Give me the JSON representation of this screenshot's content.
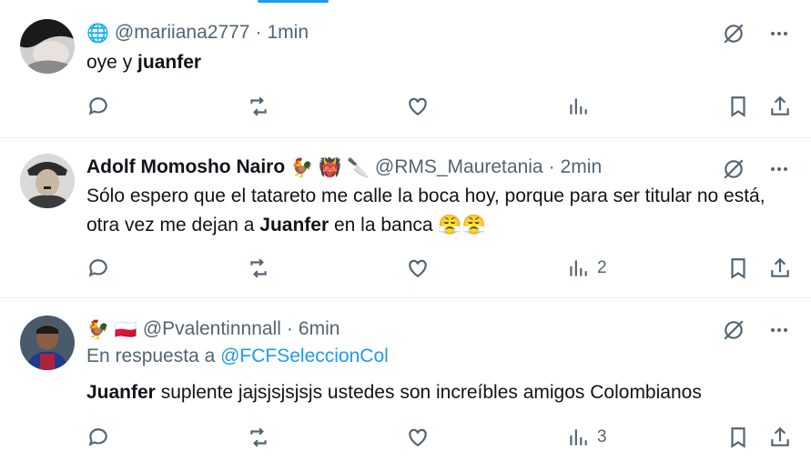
{
  "tweets": [
    {
      "avatar_icon": "avatar-photo",
      "name": "",
      "name_emojis": [],
      "handle_prefix_emojis": [
        "🌐"
      ],
      "handle": "@mariiana2777",
      "separator": "·",
      "time": "1min",
      "reply_prefix": "",
      "reply_mention": "",
      "text_before": "oye y ",
      "text_bold": "juanfer",
      "text_after": "",
      "views": ""
    },
    {
      "avatar_icon": "avatar-photo",
      "name": "Adolf Momosho Nairo",
      "name_emojis": [
        "🐓",
        "👹",
        "🔪"
      ],
      "handle_prefix_emojis": [],
      "handle": "@RMS_Mauretania",
      "separator": "·",
      "time": "2min",
      "reply_prefix": "",
      "reply_mention": "",
      "text_before": "Sólo espero que el tatareto me calle la boca hoy, porque para ser titular no está, otra vez me dejan a ",
      "text_bold": "Juanfer",
      "text_after": " en la banca 😤😤",
      "views": "2"
    },
    {
      "avatar_icon": "avatar-photo",
      "name": "",
      "name_emojis": [],
      "handle_prefix_emojis": [
        "🐓",
        "🇵🇱"
      ],
      "handle": "@Pvalentinnnall",
      "separator": "·",
      "time": "6min",
      "reply_prefix": "En respuesta a ",
      "reply_mention": "@FCFSeleccionCol",
      "text_before": "",
      "text_bold": "Juanfer",
      "text_after": " suplente jajsjsjsjsjs ustedes son increíbles amigos Colombianos",
      "views": "3"
    }
  ],
  "colors": {
    "accent": "#1d9bf0",
    "secondary_text": "#536471",
    "primary_text": "#0f1419",
    "divider": "#eff3f4"
  }
}
